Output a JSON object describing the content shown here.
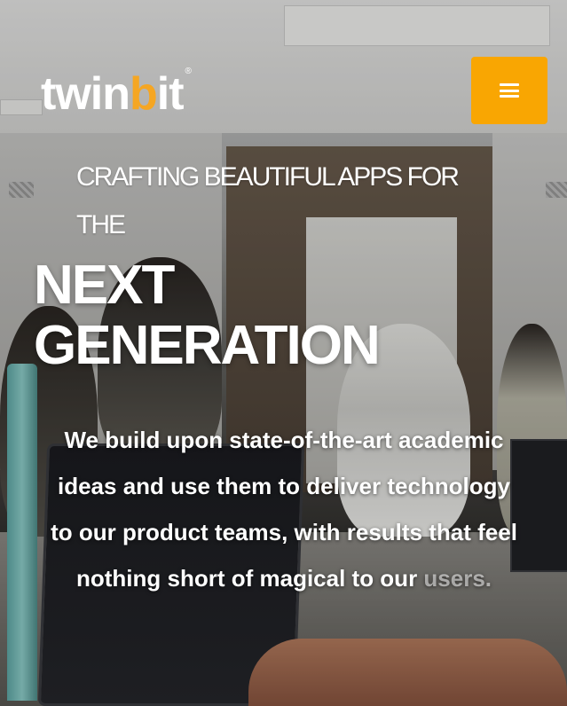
{
  "header": {
    "logo": {
      "part1": "twin",
      "part2": "b",
      "part3": "it",
      "registered": "®"
    },
    "menu_icon": "hamburger-icon"
  },
  "hero": {
    "tagline": "CRAFTING BEAUTIFUL APPS FOR THE",
    "headline_line1": "NEXT",
    "headline_line2": "GENERATION",
    "description_main": "We build upon state-of-the-art academic ideas and use them to deliver technology to our product teams, with results that feel nothing short of magical to our ",
    "description_fade": "users."
  },
  "colors": {
    "accent": "#f9a602",
    "text": "#ffffff"
  }
}
